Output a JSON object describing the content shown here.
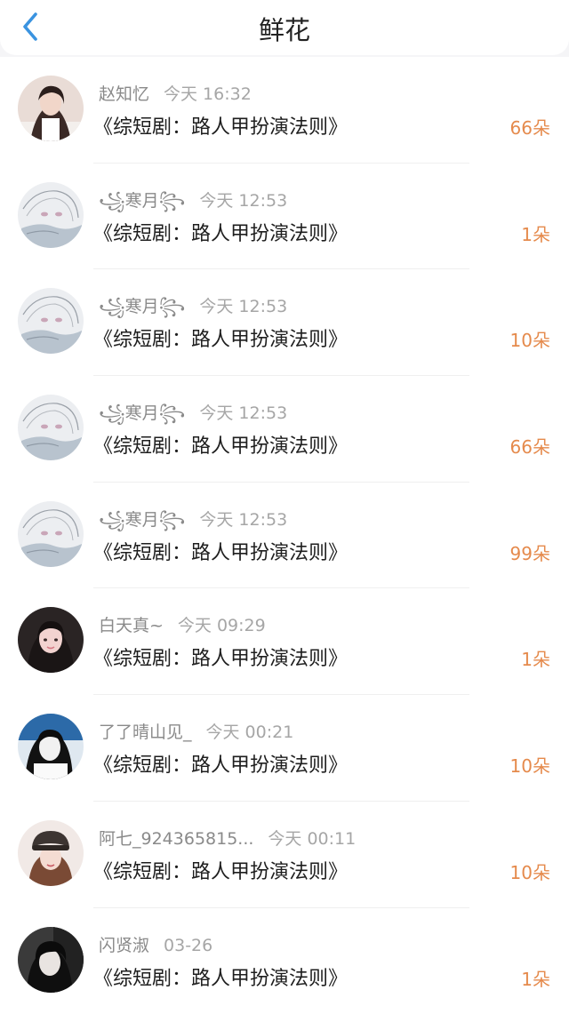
{
  "header": {
    "title": "鲜花",
    "back_icon": "chevron-left-icon",
    "accent": "#3a93e0"
  },
  "colors": {
    "count": "#e58a4c",
    "name": "#8a8a8a",
    "time": "#a6a6a6",
    "title": "#1e1e1e"
  },
  "items": [
    {
      "name": "赵知忆",
      "time": "今天 16:32",
      "book": "《综短剧：路人甲扮演法则》",
      "count": "66朵",
      "avatar": "girl-light"
    },
    {
      "name": "꧁寒月꧂",
      "time": "今天 12:53",
      "book": "《综短剧：路人甲扮演法则》",
      "count": "1朵",
      "avatar": "sketch"
    },
    {
      "name": "꧁寒月꧂",
      "time": "今天 12:53",
      "book": "《综短剧：路人甲扮演法则》",
      "count": "10朵",
      "avatar": "sketch"
    },
    {
      "name": "꧁寒月꧂",
      "time": "今天 12:53",
      "book": "《综短剧：路人甲扮演法则》",
      "count": "66朵",
      "avatar": "sketch"
    },
    {
      "name": "꧁寒月꧂",
      "time": "今天 12:53",
      "book": "《综短剧：路人甲扮演法则》",
      "count": "99朵",
      "avatar": "sketch"
    },
    {
      "name": "白天真~",
      "time": "今天 09:29",
      "book": "《综短剧：路人甲扮演法则》",
      "count": "1朵",
      "avatar": "girl-dark"
    },
    {
      "name": "了了晴山见_",
      "time": "今天 00:21",
      "book": "《综短剧：路人甲扮演法则》",
      "count": "10朵",
      "avatar": "girl-bw"
    },
    {
      "name": "阿七_924365815...",
      "time": "今天 00:11",
      "book": "《综短剧：路人甲扮演法则》",
      "count": "10朵",
      "avatar": "girl-hat"
    },
    {
      "name": "闪贤淑",
      "time": "03-26",
      "book": "《综短剧：路人甲扮演法则》",
      "count": "1朵",
      "avatar": "boy-dark"
    }
  ]
}
